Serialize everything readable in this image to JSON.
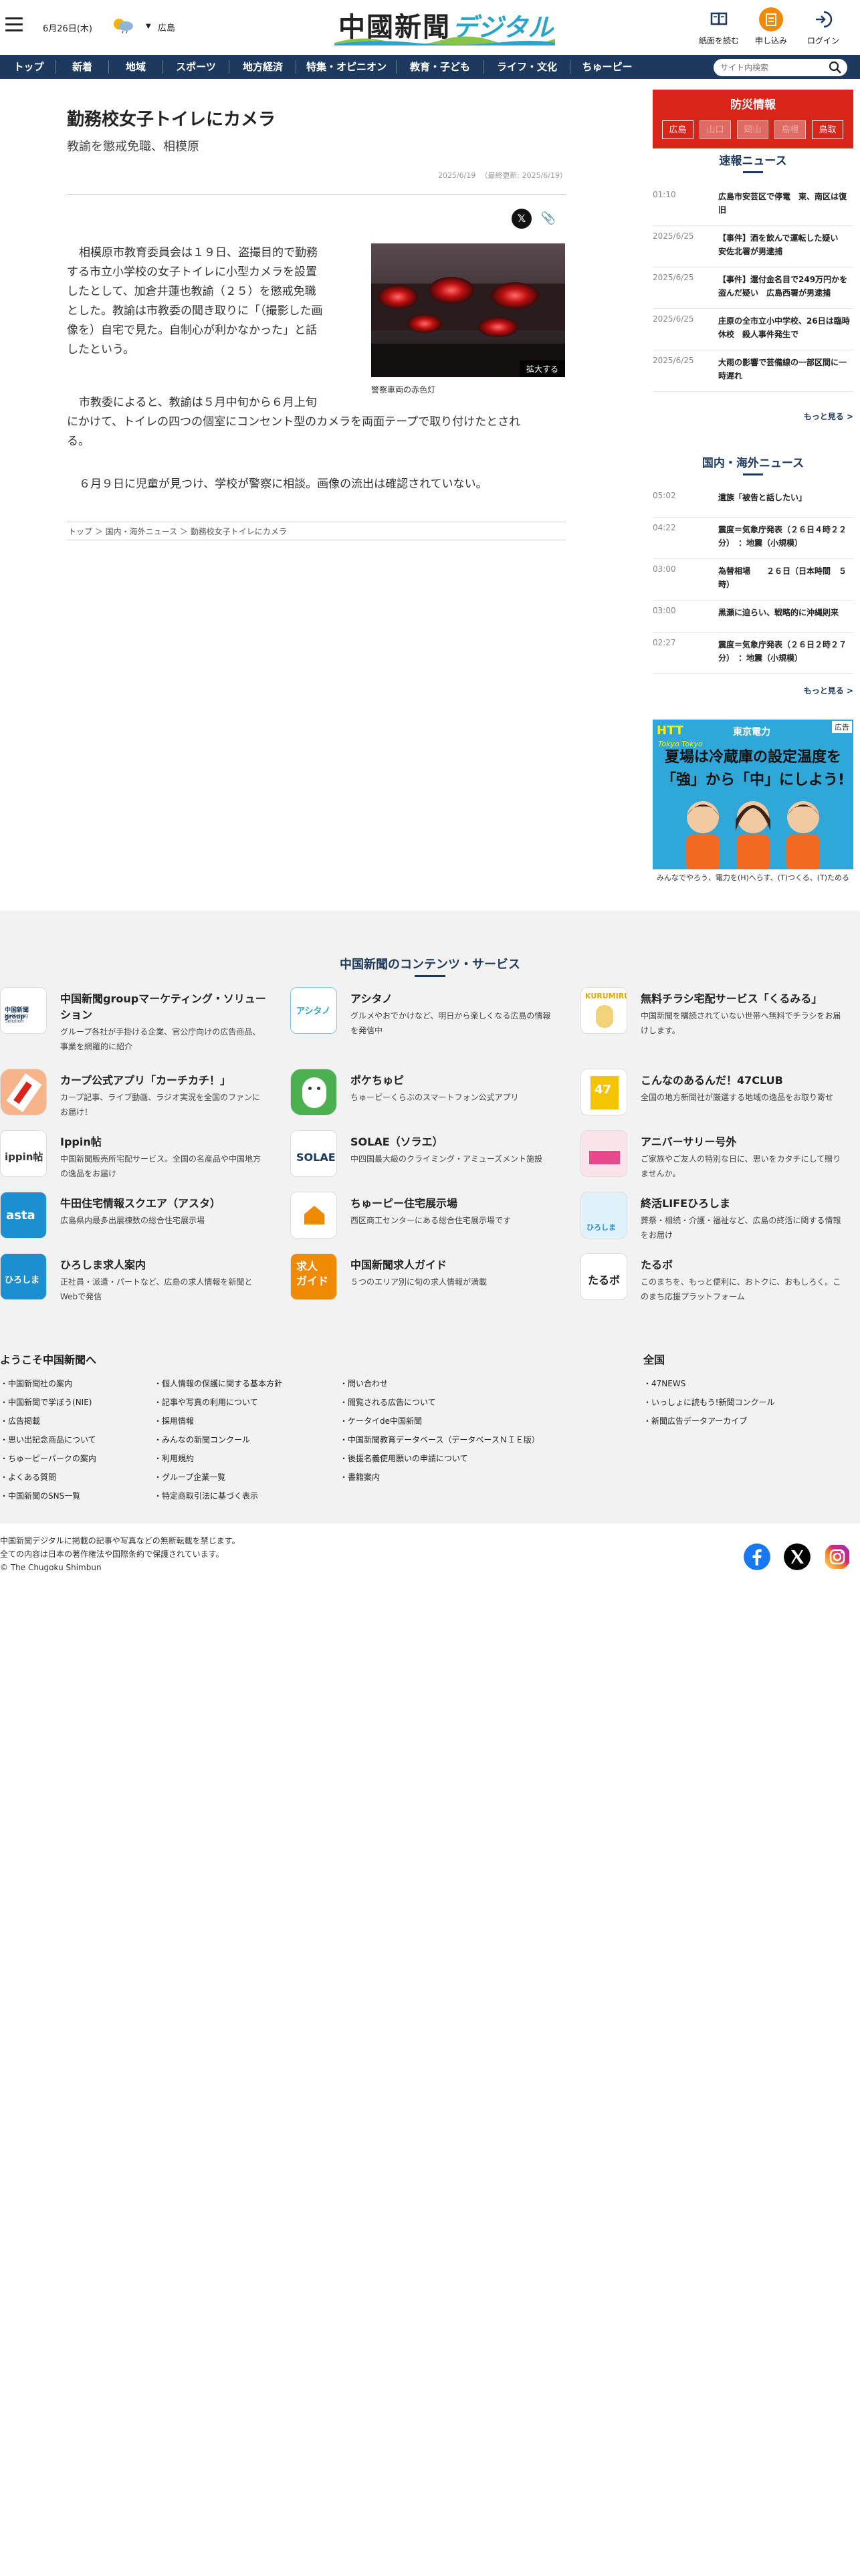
{
  "header": {
    "date": "6月26日(木)",
    "weather_city": "広島",
    "logo_main": "中國新聞",
    "logo_sub": "デジタル",
    "buttons": [
      {
        "label": "紙面を読む",
        "icon": "newspaper-icon"
      },
      {
        "label": "申し込み",
        "icon": "subscribe-icon"
      },
      {
        "label": "ログイン",
        "icon": "login-icon"
      }
    ]
  },
  "nav": {
    "items": [
      "トップ",
      "新着",
      "地域",
      "スポーツ",
      "地方経済",
      "特集・オピニオン",
      "教育・子ども",
      "ライフ・文化",
      "ちゅーピー"
    ],
    "search_placeholder": "サイト内検索"
  },
  "article": {
    "title": "勤務校女子トイレにカメラ",
    "subtitle": "教諭を懲戒免職、相模原",
    "date": "2025/6/19",
    "updated": "（最終更新: 2025/6/19）",
    "paragraphs": [
      "相模原市教育委員会は１９日、盗撮目的で勤務",
      "する市立小学校の女子トイレに小型カメラを設置",
      "したとして、加倉井蓮也教諭（２５）を懲戒免職",
      "とした。教諭は市教委の聞き取りに「（撮影した画",
      "像を）自宅で見た。自制心が利かなかった」と話",
      "したという。",
      "市教委によると、教諭は５月中旬から６月上旬",
      "にかけて、トイレの四つの個室にコンセント型のカメラを両面テープで取り付けたとされ",
      "る。",
      "６月９日に児童が見つけ、学校が警察に相談。画像の流出は確認されていない。"
    ],
    "photo_caption": "警察車両の赤色灯",
    "photo_zoom": "拡大する",
    "breadcrumb": [
      "トップ",
      "国内・海外ニュース",
      "勤務校女子トイレにカメラ"
    ]
  },
  "sidebar": {
    "bousai_title": "防災情報",
    "prefectures": [
      {
        "name": "広島",
        "active": true
      },
      {
        "name": "山口",
        "active": false
      },
      {
        "name": "岡山",
        "active": false
      },
      {
        "name": "島根",
        "active": false
      },
      {
        "name": "鳥取",
        "active": true
      }
    ],
    "breaking_title": "速報ニュース",
    "breaking": [
      {
        "time": "01:10",
        "text": "広島市安芸区で停電　東、南区は復旧"
      },
      {
        "time": "2025/6/25",
        "text": "【事件】酒を飲んで運転した疑い　安佐北署が男逮捕"
      },
      {
        "time": "2025/6/25",
        "text": "【事件】還付金名目で249万円かを盗んだ疑い　広島西署が男逮捕"
      },
      {
        "time": "2025/6/25",
        "text": "庄原の全市立小中学校、26日は臨時休校　殺人事件発生で"
      },
      {
        "time": "2025/6/25",
        "text": "大雨の影響で芸備線の一部区間に一時遅れ"
      }
    ],
    "more1": "もっと見る >",
    "world_title": "国内・海外ニュース",
    "world": [
      {
        "time": "05:02",
        "text": "遺族「被告と話したい」"
      },
      {
        "time": "04:22",
        "text": "震度＝気象庁発表（２６日４時２２分）　：地震（小規模）"
      },
      {
        "time": "03:00",
        "text": "為替相場　　２６日（日本時間　５時）"
      },
      {
        "time": "03:00",
        "text": "黒瀬に迫らい、戦略的に沖縄則来"
      },
      {
        "time": "02:27",
        "text": "震度＝気象庁発表（２６日２時２７分）　：地震（小規模）"
      }
    ],
    "more2": "もっと見る >",
    "ad": {
      "badge": "広告",
      "brand": "HTT",
      "brand_sub": "Tokyo Tokyo",
      "tepco": "東京電力",
      "headline1": "夏場は冷蔵庫の設定温度を",
      "headline2": "「強」から「中」にしよう!",
      "footer": "みんなでやろう、電力を(H)へらす、(T)つくる、(T)ためる"
    }
  },
  "services": {
    "title": "中国新聞のコンテンツ・サービス",
    "items": [
      {
        "name": "中国新聞groupマーケティング・ソリューション",
        "desc": "グループ各社が手掛ける企業、官公庁向けの広告商品、事業を網羅的に紹介",
        "icon": "marketing-logo-icon"
      },
      {
        "name": "アシタノ",
        "desc": "グルメやおでかけなど、明日から楽しくなる広島の情報を発信中",
        "icon": "ashitano-logo-icon"
      },
      {
        "name": "無料チラシ宅配サービス「くるみる」",
        "desc": "中国新聞を購読されていない世帯へ無料でチラシをお届けします。",
        "icon": "kurumiru-logo-icon"
      },
      {
        "name": "カープ公式アプリ「カーチカチ！」",
        "desc": "カープ記事、ライブ動画、ラジオ実況を全国のファンにお届け！",
        "icon": "carp-app-icon"
      },
      {
        "name": "ポケちゅピ",
        "desc": "ちゅーピーくらぶのスマートフォン公式アプリ",
        "icon": "pokechupi-icon"
      },
      {
        "name": "こんなのあるんだ！47CLUB",
        "desc": "全国の地方新聞社が厳選する地域の逸品をお取り寄せ",
        "icon": "47club-logo-icon"
      },
      {
        "name": "Ippin帖",
        "desc": "中国新聞販売所宅配サービス。全国の名産品や中国地方の逸品をお届け",
        "icon": "ippin-logo-icon"
      },
      {
        "name": "SOLAE（ソラエ）",
        "desc": "中四国最大級のクライミング・アミューズメント施設",
        "icon": "solae-logo-icon"
      },
      {
        "name": "アニバーサリー号外",
        "desc": "ご家族やご友人の特別な日に、思いをカタチにして贈りませんか。",
        "icon": "anniversary-icon"
      },
      {
        "name": "牛田住宅情報スクエア（アスタ）",
        "desc": "広島県内最多出展棟数の総合住宅展示場",
        "icon": "asta-logo-icon"
      },
      {
        "name": "ちゅーピー住宅展示場",
        "desc": "西区商工センターにある総合住宅展示場です",
        "icon": "chupy-house-icon"
      },
      {
        "name": "終活LIFEひろしま",
        "desc": "葬祭・相続・介護・福祉など、広島の終活に関する情報をお届け",
        "icon": "shukatsu-logo-icon"
      },
      {
        "name": "ひろしま求人案内",
        "desc": "正社員・派遣・パートなど、広島の求人情報を新聞とWebで発信",
        "icon": "kyujin-logo-icon"
      },
      {
        "name": "中国新聞求人ガイド",
        "desc": "５つのエリア別に旬の求人情報が満載",
        "icon": "kyujin-guide-icon"
      },
      {
        "name": "たるボ",
        "desc": "このまちを、もっと便利に、おトクに、おもしろく。このまち応援プラットフォーム",
        "icon": "tarubo-logo-icon"
      }
    ]
  },
  "footer": {
    "welcome_title": "ようこそ中国新聞へ",
    "col1": [
      "中国新聞社の案内",
      "中国新聞で学ぼう(NIE)",
      "広告掲載",
      "思い出記念商品について",
      "ちゅーピーパークの案内",
      "よくある質問",
      "中国新聞のSNS一覧"
    ],
    "col2": [
      "個人情報の保護に関する基本方針",
      "記事や写真の利用について",
      "採用情報",
      "みんなの新聞コンクール",
      "利用規約",
      "グループ企業一覧",
      "特定商取引法に基づく表示"
    ],
    "col3": [
      "問い合わせ",
      "閲覧される広告について",
      "ケータイde中国新聞",
      "中国新聞教育データベース（データベースＮＩＥ版）",
      "後援名義使用願いの申請について",
      "書籍案内"
    ],
    "zenkoku_title": "全国",
    "col4": [
      "47NEWS",
      "いっしょに読もう!新聞コンクール",
      "新聞広告データアーカイブ"
    ],
    "copy1": "中国新聞デジタルに掲載の記事や写真などの無断転載を禁じます。",
    "copy2": "全ての内容は日本の著作権法や国際条約で保護されています。",
    "copy3": "© The Chugoku Shimbun"
  },
  "colors": {
    "navy": "#1d3a5e",
    "red": "#d9241a",
    "accent_blue": "#2aa5c7",
    "orange": "#f08a00"
  }
}
